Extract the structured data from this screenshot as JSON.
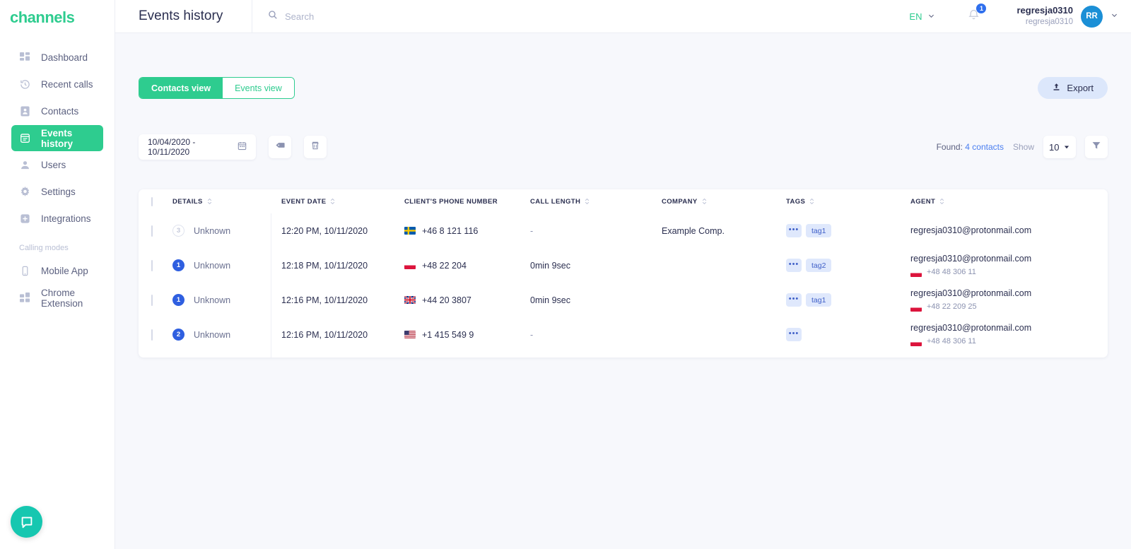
{
  "brand": {
    "logo_text": "channels",
    "accent": "#2ecc8f"
  },
  "sidebar": {
    "items": [
      {
        "label": "Dashboard",
        "icon": "dashboard-icon",
        "active": false
      },
      {
        "label": "Recent calls",
        "icon": "history-icon",
        "active": false
      },
      {
        "label": "Contacts",
        "icon": "contacts-icon",
        "active": false
      },
      {
        "label": "Events history",
        "icon": "events-icon",
        "active": true
      },
      {
        "label": "Users",
        "icon": "user-icon",
        "active": false
      },
      {
        "label": "Settings",
        "icon": "gear-icon",
        "active": false
      },
      {
        "label": "Integrations",
        "icon": "integrations-icon",
        "active": false
      }
    ],
    "section_label": "Calling modes",
    "calling_modes": [
      {
        "label": "Mobile App",
        "icon": "mobile-icon"
      },
      {
        "label": "Chrome Extension",
        "icon": "chrome-extension-icon"
      }
    ],
    "chat_icon": "chat-bubble-icon"
  },
  "header": {
    "title": "Events history",
    "search_placeholder": "Search",
    "search_value": "",
    "language": "EN",
    "notification_count": "1",
    "user_name": "regresja0310",
    "user_sub": "regresja0310",
    "avatar_initials": "RR"
  },
  "toolbar": {
    "tabs": [
      {
        "label": "Contacts view",
        "active": true
      },
      {
        "label": "Events view",
        "active": false
      }
    ],
    "export_label": "Export"
  },
  "filters": {
    "date_range": "10/04/2020 - 10/11/2020",
    "calendar_icon": "calendar-icon",
    "tag_button_icon": "tag-icon",
    "delete_button_icon": "trash-icon",
    "found_prefix": "Found:",
    "found_value": "4 contacts",
    "show_label": "Show",
    "show_value": "10",
    "funnel_icon": "funnel-icon"
  },
  "table": {
    "columns": [
      {
        "label": "DETAILS",
        "sortable": true
      },
      {
        "label": "EVENT DATE",
        "sortable": true
      },
      {
        "label": "CLIENT'S PHONE NUMBER",
        "sortable": false
      },
      {
        "label": "CALL LENGTH",
        "sortable": true
      },
      {
        "label": "COMPANY",
        "sortable": true
      },
      {
        "label": "TAGS",
        "sortable": true
      },
      {
        "label": "AGENT",
        "sortable": true
      }
    ],
    "rows": [
      {
        "badge": "3",
        "badge_style": "grey",
        "details": "Unknown",
        "event_date": "12:20 PM, 10/11/2020",
        "flag": "se",
        "phone": "+46 8 121 116",
        "call_length": "-",
        "company": "Example Comp.",
        "tags": [
          "tag1"
        ],
        "agent_email": "regresja0310@protonmail.com",
        "agent_flag": "",
        "agent_phone": ""
      },
      {
        "badge": "1",
        "badge_style": "blue",
        "details": "Unknown",
        "event_date": "12:18 PM, 10/11/2020",
        "flag": "pl",
        "phone": "+48 22 204",
        "call_length": "0min 9sec",
        "company": "",
        "tags": [
          "tag2"
        ],
        "agent_email": "regresja0310@protonmail.com",
        "agent_flag": "pl",
        "agent_phone": "+48 48 306 11"
      },
      {
        "badge": "1",
        "badge_style": "blue",
        "details": "Unknown",
        "event_date": "12:16 PM, 10/11/2020",
        "flag": "gb",
        "phone": "+44 20 3807",
        "call_length": "0min 9sec",
        "company": "",
        "tags": [
          "tag1"
        ],
        "agent_email": "regresja0310@protonmail.com",
        "agent_flag": "pl",
        "agent_phone": "+48 22 209 25"
      },
      {
        "badge": "2",
        "badge_style": "blue",
        "details": "Unknown",
        "event_date": "12:16 PM, 10/11/2020",
        "flag": "us",
        "phone": "+1 415 549 9",
        "call_length": "-",
        "company": "",
        "tags": [],
        "agent_email": "regresja0310@protonmail.com",
        "agent_flag": "pl",
        "agent_phone": "+48 48 306 11"
      }
    ],
    "tag_more_label": "•••"
  }
}
